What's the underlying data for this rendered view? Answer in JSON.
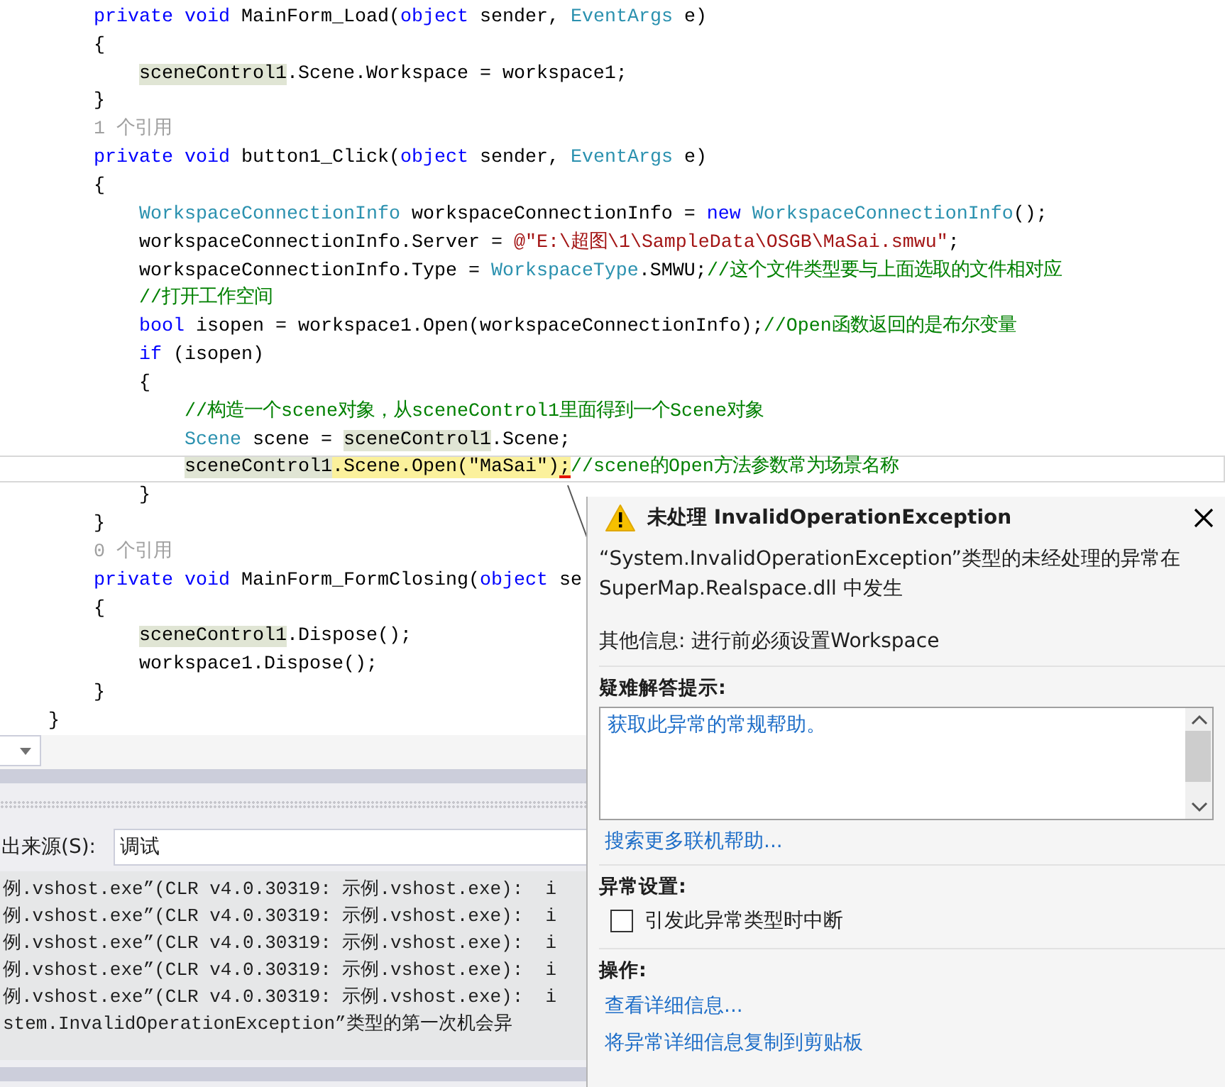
{
  "editor": {
    "lines": [
      {
        "current": false,
        "tokens": [
          {
            "text": "private void ",
            "kind": "keyword"
          },
          {
            "text": "MainForm_Load(",
            "kind": "plain"
          },
          {
            "text": "object ",
            "kind": "keyword"
          },
          {
            "text": "sender, ",
            "kind": "plain"
          },
          {
            "text": "EventArgs ",
            "kind": "type"
          },
          {
            "text": "e)",
            "kind": "plain"
          }
        ]
      },
      {
        "current": false,
        "tokens": [
          {
            "text": "{",
            "kind": "plain"
          }
        ],
        "children": [
          {
            "current": false,
            "tokens": [
              {
                "text": "sceneControl1",
                "kind": "reference"
              },
              {
                "text": ".Scene.Workspace = workspace1;",
                "kind": "plain"
              }
            ]
          }
        ]
      },
      {
        "current": false,
        "tokens": [
          {
            "text": "}",
            "kind": "plain"
          }
        ]
      },
      {
        "current": false,
        "tokens": [
          {
            "text": "1 个引用",
            "kind": "refcount"
          }
        ]
      },
      {
        "current": false,
        "tokens": [
          {
            "text": "private void ",
            "kind": "keyword"
          },
          {
            "text": "button1_Click(",
            "kind": "plain"
          },
          {
            "text": "object ",
            "kind": "keyword"
          },
          {
            "text": "sender, ",
            "kind": "plain"
          },
          {
            "text": "EventArgs ",
            "kind": "type"
          },
          {
            "text": "e)",
            "kind": "plain"
          }
        ]
      },
      {
        "current": false,
        "tokens": [
          {
            "text": "{",
            "kind": "plain"
          }
        ],
        "children": [
          {
            "current": false,
            "tokens": [
              {
                "text": "WorkspaceConnectionInfo ",
                "kind": "type"
              },
              {
                "text": "workspaceConnectionInfo = ",
                "kind": "plain"
              },
              {
                "text": "new ",
                "kind": "keyword"
              },
              {
                "text": "WorkspaceConnectionInfo",
                "kind": "type"
              },
              {
                "text": "();",
                "kind": "plain"
              }
            ]
          },
          {
            "current": false,
            "tokens": [
              {
                "text": "workspaceConnectionInfo.Server = ",
                "kind": "plain"
              },
              {
                "text": "@\"E:\\超图\\1\\SampleData\\OSGB\\MaSai.smwu\"",
                "kind": "string"
              },
              {
                "text": ";",
                "kind": "plain"
              }
            ]
          },
          {
            "current": false,
            "tokens": [
              {
                "text": "workspaceConnectionInfo.Type = ",
                "kind": "plain"
              },
              {
                "text": "WorkspaceType",
                "kind": "type"
              },
              {
                "text": ".SMWU;",
                "kind": "plain"
              },
              {
                "text": "//这个文件类型要与上面选取的文件相对应",
                "kind": "comment"
              }
            ]
          },
          {
            "current": false,
            "tokens": [
              {
                "text": "//打开工作空间",
                "kind": "comment"
              }
            ]
          },
          {
            "current": false,
            "tokens": [
              {
                "text": "bool ",
                "kind": "keyword"
              },
              {
                "text": "isopen = workspace1.Open(workspaceConnectionInfo);",
                "kind": "plain"
              },
              {
                "text": "//Open函数返回的是布尔变量",
                "kind": "comment"
              }
            ]
          },
          {
            "current": false,
            "tokens": [
              {
                "text": "if ",
                "kind": "keyword"
              },
              {
                "text": "(isopen)",
                "kind": "plain"
              }
            ]
          },
          {
            "current": false,
            "tokens": [
              {
                "text": "{",
                "kind": "plain"
              }
            ],
            "children": [
              {
                "current": false,
                "tokens": [
                  {
                    "text": "//构造一个scene对象，从sceneControl1里面得到一个Scene对象",
                    "kind": "comment"
                  }
                ]
              },
              {
                "current": false,
                "tokens": [
                  {
                    "text": "Scene ",
                    "kind": "type"
                  },
                  {
                    "text": "scene = ",
                    "kind": "plain"
                  },
                  {
                    "text": "sceneControl1",
                    "kind": "reference"
                  },
                  {
                    "text": ".Scene;",
                    "kind": "plain"
                  }
                ]
              },
              {
                "current": true,
                "tokens": [
                  {
                    "text": "sceneControl1",
                    "kind": "reference"
                  },
                  {
                    "text": ".Scene.Open(\"MaSai\")",
                    "kind": "statement"
                  },
                  {
                    "text": ";",
                    "kind": "statement-error"
                  },
                  {
                    "text": "//scene的Open方法参数常为场景名称",
                    "kind": "comment"
                  }
                ]
              }
            ]
          },
          {
            "current": false,
            "tokens": [
              {
                "text": "}",
                "kind": "plain"
              }
            ]
          }
        ]
      },
      {
        "current": false,
        "tokens": [
          {
            "text": "}",
            "kind": "plain"
          }
        ]
      },
      {
        "current": false,
        "tokens": [
          {
            "text": "0 个引用",
            "kind": "refcount"
          }
        ]
      },
      {
        "current": false,
        "tokens": [
          {
            "text": "private void ",
            "kind": "keyword"
          },
          {
            "text": "MainForm_FormClosing(",
            "kind": "plain"
          },
          {
            "text": "object ",
            "kind": "keyword"
          },
          {
            "text": "se",
            "kind": "plain"
          }
        ]
      },
      {
        "current": false,
        "tokens": [
          {
            "text": "{",
            "kind": "plain"
          }
        ],
        "children": [
          {
            "current": false,
            "tokens": [
              {
                "text": "sceneControl1",
                "kind": "reference"
              },
              {
                "text": ".Dispose();",
                "kind": "plain"
              }
            ]
          },
          {
            "current": false,
            "tokens": [
              {
                "text": "workspace1.Dispose();",
                "kind": "plain"
              }
            ]
          }
        ]
      },
      {
        "current": false,
        "tokens": [
          {
            "text": "}",
            "kind": "plain"
          }
        ]
      }
    ],
    "class_closing": {
      "current": false,
      "tokens": [
        {
          "text": "}",
          "kind": "plain"
        }
      ]
    }
  },
  "output": {
    "source_label": "出来源(S):",
    "source_value": "调试",
    "lines": [
      "例.vshost.exe”(CLR v4.0.30319: 示例.vshost.exe):  i",
      "例.vshost.exe”(CLR v4.0.30319: 示例.vshost.exe):  i",
      "例.vshost.exe”(CLR v4.0.30319: 示例.vshost.exe):  i",
      "例.vshost.exe”(CLR v4.0.30319: 示例.vshost.exe):  i",
      "例.vshost.exe”(CLR v4.0.30319: 示例.vshost.exe):  i",
      "stem.InvalidOperationException”类型的第一次机会异"
    ]
  },
  "exception_popup": {
    "title": "未处理 InvalidOperationException",
    "message": "“System.InvalidOperationException”类型的未经处理的异常在 SuperMap.Realspace.dll 中发生",
    "additional_info": "其他信息: 进行前必须设置Workspace",
    "troubleshooting_heading": "疑难解答提示:",
    "troubleshooting_tips": [
      "获取此异常的常规帮助。"
    ],
    "search_link": "搜索更多联机帮助...",
    "settings_heading": "异常设置:",
    "break_checkbox": {
      "label": "引发此异常类型时中断",
      "checked": false
    },
    "actions_heading": "操作:",
    "actions": [
      "查看详细信息...",
      "将异常详细信息复制到剪贴板"
    ]
  }
}
